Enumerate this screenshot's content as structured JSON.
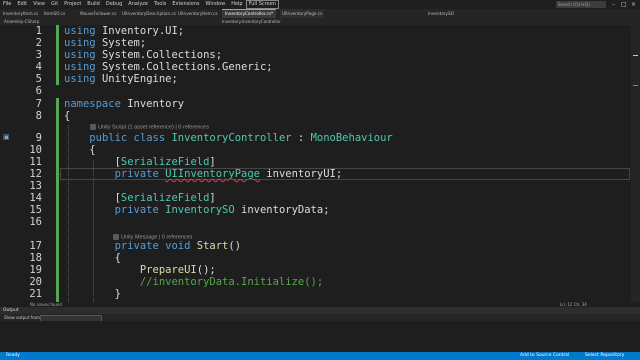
{
  "menu": [
    "File",
    "Edit",
    "View",
    "Git",
    "Project",
    "Build",
    "Debug",
    "Analyze",
    "Tools",
    "Extensions",
    "Window",
    "Help"
  ],
  "fullscreen_label": "Full Screen",
  "search_placeholder": "Search (Ctrl+Q)",
  "tabs": [
    "InventoryItem.cs",
    "ItemSO.cs",
    "MouseFollower.cs",
    "UIInventoryDescription.cs",
    "UIInventoryItem.cs",
    "InventoryController.cs*",
    "UIInventoryPage.cs"
  ],
  "right_tab": "InventorySO",
  "toolbar": {
    "project": "Assembly-CSharp",
    "class": "Inventory.InventoryController"
  },
  "code_lines": [
    {
      "n": "1",
      "parts": [
        [
          "kw",
          "using "
        ],
        [
          "id",
          "Inventory.UI;"
        ]
      ]
    },
    {
      "n": "2",
      "parts": [
        [
          "kw",
          "using "
        ],
        [
          "id",
          "System;"
        ]
      ]
    },
    {
      "n": "3",
      "parts": [
        [
          "kw",
          "using "
        ],
        [
          "id",
          "System.Collections;"
        ]
      ]
    },
    {
      "n": "4",
      "parts": [
        [
          "kw",
          "using "
        ],
        [
          "id",
          "System.Collections.Generic;"
        ]
      ]
    },
    {
      "n": "5",
      "parts": [
        [
          "kw",
          "using "
        ],
        [
          "id",
          "UnityEngine;"
        ]
      ]
    },
    {
      "n": "6",
      "parts": []
    },
    {
      "n": "7",
      "parts": [
        [
          "kw",
          "namespace "
        ],
        [
          "id",
          "Inventory"
        ]
      ]
    },
    {
      "n": "8",
      "parts": [
        [
          "id",
          "{"
        ]
      ]
    },
    {
      "n": "9",
      "parts": [
        [
          "id",
          "    "
        ],
        [
          "kw",
          "public class "
        ],
        [
          "ty",
          "InventoryController"
        ],
        [
          "id",
          " : "
        ],
        [
          "ty",
          "MonoBehaviour"
        ]
      ]
    },
    {
      "n": "10",
      "parts": [
        [
          "id",
          "    {"
        ]
      ]
    },
    {
      "n": "11",
      "parts": [
        [
          "id",
          "        ["
        ],
        [
          "at",
          "SerializeField"
        ],
        [
          "id",
          "]"
        ]
      ]
    },
    {
      "n": "12",
      "parts": [
        [
          "id",
          "        "
        ],
        [
          "kw",
          "private "
        ],
        [
          "ty",
          "UIInventoryPage"
        ],
        [
          "id",
          " inventoryUI;"
        ]
      ]
    },
    {
      "n": "13",
      "parts": []
    },
    {
      "n": "14",
      "parts": [
        [
          "id",
          "        ["
        ],
        [
          "at",
          "SerializeField"
        ],
        [
          "id",
          "]"
        ]
      ]
    },
    {
      "n": "15",
      "parts": [
        [
          "id",
          "        "
        ],
        [
          "kw",
          "private "
        ],
        [
          "ty",
          "InventorySO"
        ],
        [
          "id",
          " inventoryData;"
        ]
      ]
    },
    {
      "n": "16",
      "parts": []
    },
    {
      "n": "17",
      "parts": [
        [
          "id",
          "        "
        ],
        [
          "kw",
          "private void "
        ],
        [
          "fn",
          "Start"
        ],
        [
          "id",
          "()"
        ]
      ]
    },
    {
      "n": "18",
      "parts": [
        [
          "id",
          "        {"
        ]
      ]
    },
    {
      "n": "19",
      "parts": [
        [
          "id",
          "            "
        ],
        [
          "fn",
          "PrepareUI"
        ],
        [
          "id",
          "();"
        ]
      ]
    },
    {
      "n": "20",
      "parts": [
        [
          "id",
          "            "
        ],
        [
          "cm",
          "//inventoryData.Initialize();"
        ]
      ]
    },
    {
      "n": "21",
      "parts": [
        [
          "id",
          "        }"
        ]
      ]
    }
  ],
  "codelens": [
    {
      "text": "Unity Script (1 asset reference) | 0 references"
    },
    {
      "text": "Unity Message | 0 references"
    }
  ],
  "status_left": "No issues found",
  "position": "Ln: 12  Ch: 34",
  "output_title": "Output",
  "output_show_label": "Show output from:",
  "status_ready": "Ready",
  "status_add_source": "Add to Source Control",
  "status_repo": "Select Repository"
}
